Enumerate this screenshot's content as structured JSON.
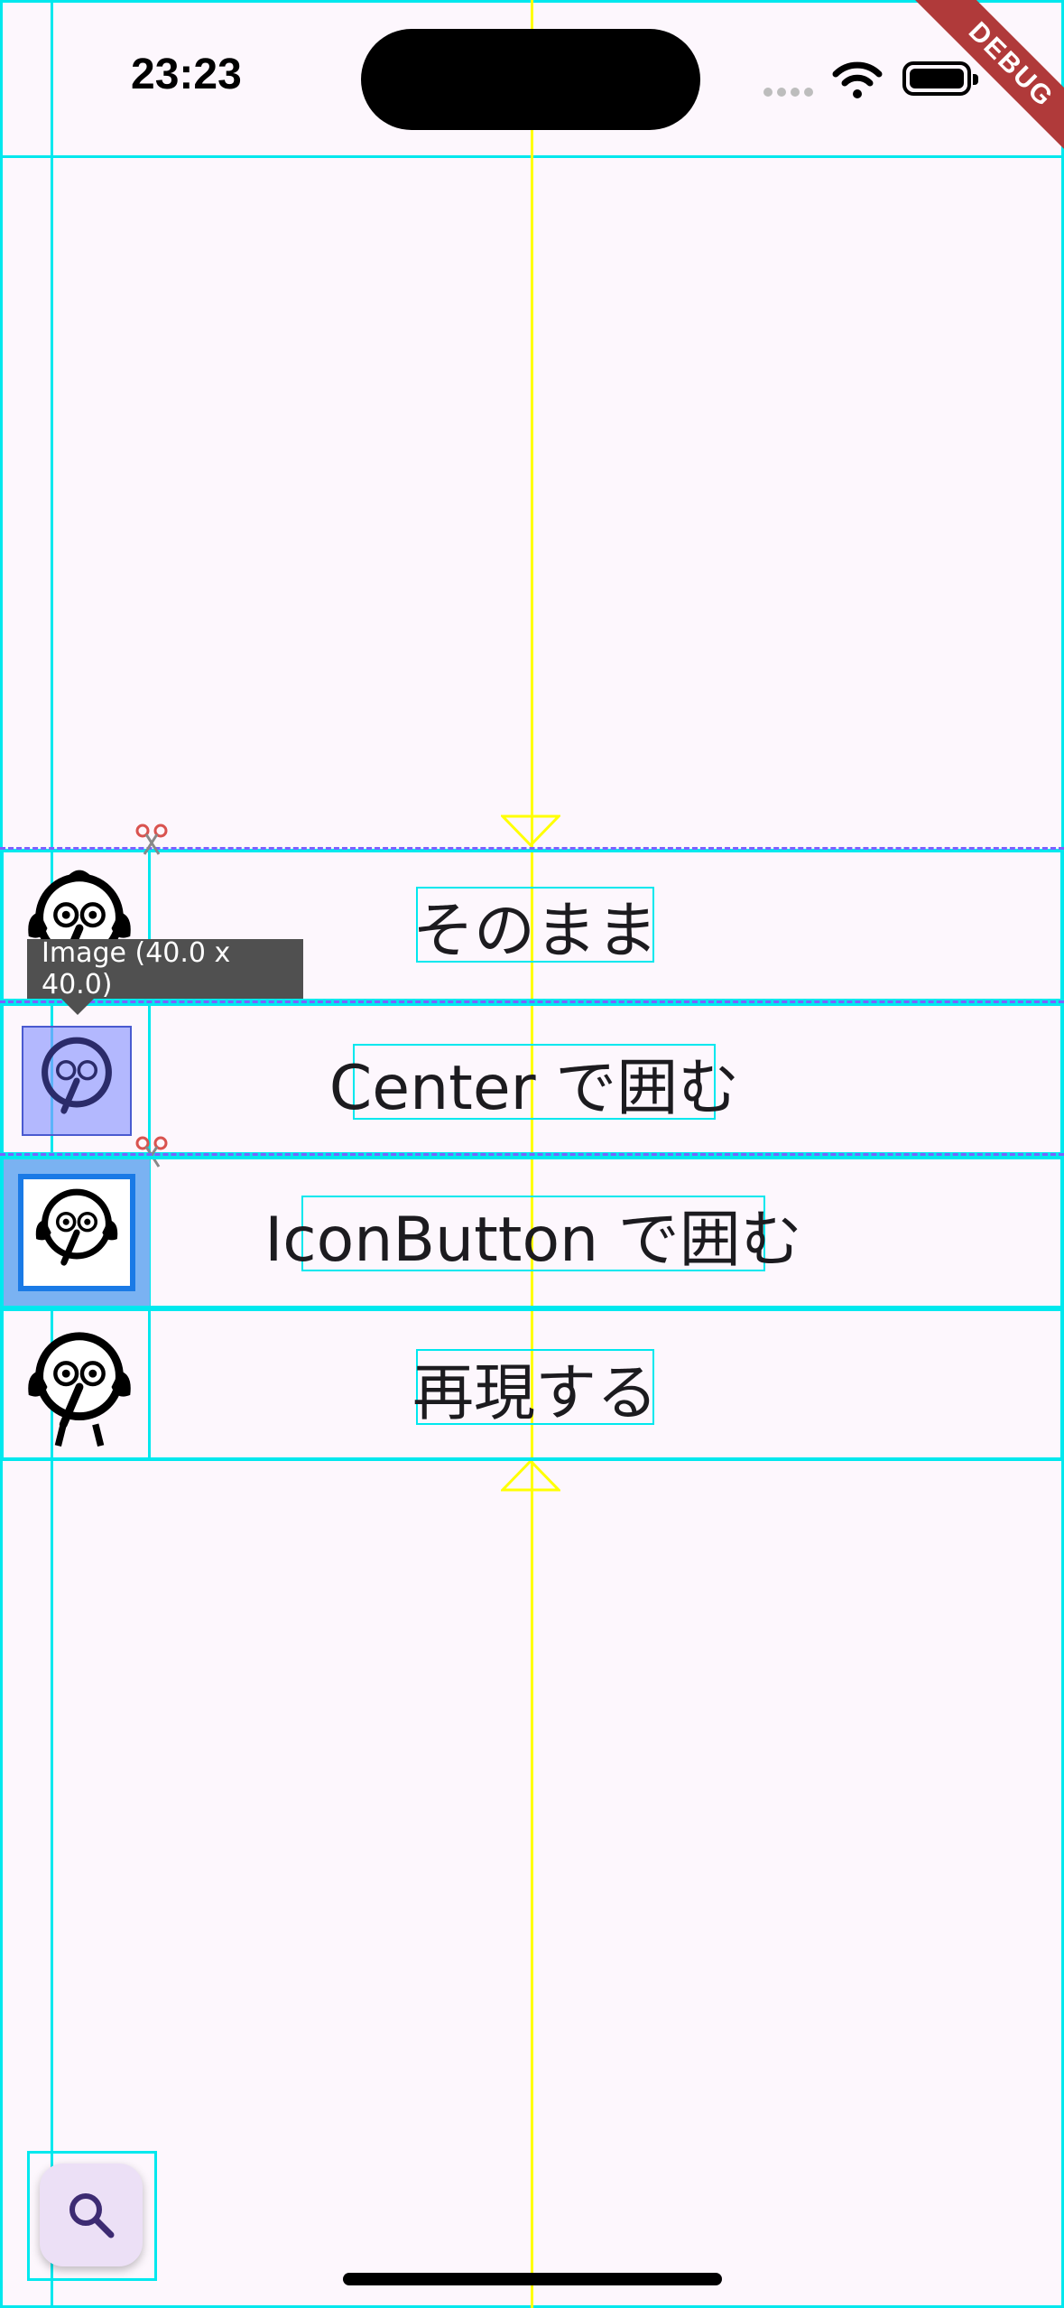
{
  "status_bar": {
    "time": "23:23",
    "wifi_icon": "wifi-icon",
    "battery_icon": "battery-icon"
  },
  "debug_banner": "DEBUG",
  "rows": [
    {
      "label": "そのまま",
      "icon": "bird-avatar-icon"
    },
    {
      "label": "Center で囲む",
      "icon": "bird-avatar-icon"
    },
    {
      "label": "IconButton で囲む",
      "icon": "bird-avatar-icon"
    },
    {
      "label": "再現する",
      "icon": "bird-avatar-icon"
    }
  ],
  "inspector": {
    "tooltip": "Image (40.0 x 40.0)",
    "fab_icon": "search-icon"
  },
  "colors": {
    "background": "#fdf7fd",
    "debug_outline": "#00e8ee",
    "guide": "#ffff00",
    "selection": "#8c96ff",
    "ribbon": "#b03a3a"
  }
}
